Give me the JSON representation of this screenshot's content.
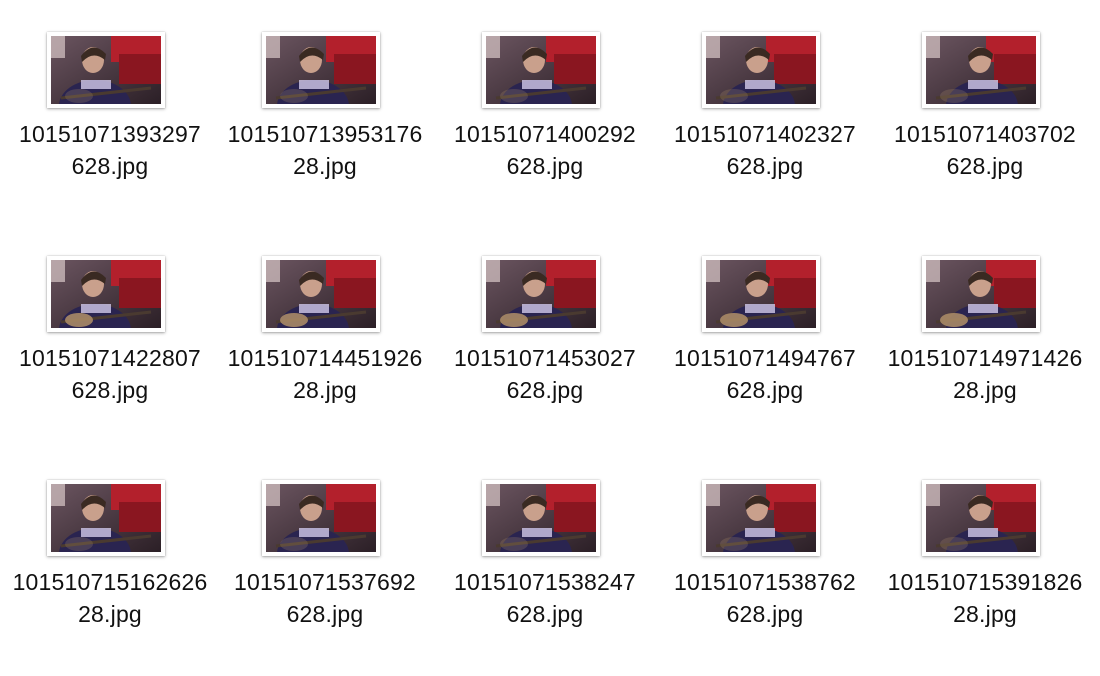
{
  "files": [
    {
      "name_line1": "10151071393297",
      "name_line2": "628.jpg",
      "icon": "image-thumbnail-icon",
      "variant": 0
    },
    {
      "name_line1": "101510713953176",
      "name_line2": "28.jpg",
      "icon": "image-thumbnail-icon",
      "variant": 1
    },
    {
      "name_line1": "10151071400292",
      "name_line2": "628.jpg",
      "icon": "image-thumbnail-icon",
      "variant": 2
    },
    {
      "name_line1": "10151071402327",
      "name_line2": "628.jpg",
      "icon": "image-thumbnail-icon",
      "variant": 3
    },
    {
      "name_line1": "10151071403702",
      "name_line2": "628.jpg",
      "icon": "image-thumbnail-icon",
      "variant": 4
    },
    {
      "name_line1": "10151071422807",
      "name_line2": "628.jpg",
      "icon": "image-thumbnail-icon",
      "variant": 5
    },
    {
      "name_line1": "101510714451926",
      "name_line2": "28.jpg",
      "icon": "image-thumbnail-icon",
      "variant": 6
    },
    {
      "name_line1": "10151071453027",
      "name_line2": "628.jpg",
      "icon": "image-thumbnail-icon",
      "variant": 7
    },
    {
      "name_line1": "10151071494767",
      "name_line2": "628.jpg",
      "icon": "image-thumbnail-icon",
      "variant": 8
    },
    {
      "name_line1": "101510714971426",
      "name_line2": "28.jpg",
      "icon": "image-thumbnail-icon",
      "variant": 9
    },
    {
      "name_line1": "101510715162626",
      "name_line2": "28.jpg",
      "icon": "image-thumbnail-icon",
      "variant": 10
    },
    {
      "name_line1": "10151071537692",
      "name_line2": "628.jpg",
      "icon": "image-thumbnail-icon",
      "variant": 11
    },
    {
      "name_line1": "10151071538247",
      "name_line2": "628.jpg",
      "icon": "image-thumbnail-icon",
      "variant": 12
    },
    {
      "name_line1": "10151071538762",
      "name_line2": "628.jpg",
      "icon": "image-thumbnail-icon",
      "variant": 13
    },
    {
      "name_line1": "101510715391826",
      "name_line2": "28.jpg",
      "icon": "image-thumbnail-icon",
      "variant": 14
    }
  ],
  "colors": {
    "background": "#ffffff",
    "text": "#111111",
    "thumb_wall": "#6b5560",
    "thumb_red": "#b3202c",
    "thumb_shirt": "#2a2450",
    "thumb_skin": "#c9a08c",
    "thumb_hair": "#3a2a22"
  }
}
